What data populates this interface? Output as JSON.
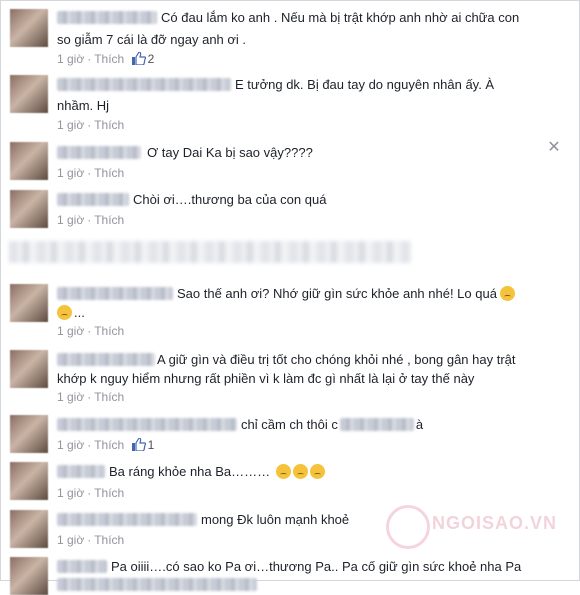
{
  "meta_like_label": "Thích",
  "meta_separator": "·",
  "comments": [
    {
      "text1": "Có đau lắm ko anh . Nếu mà bị trật khớp anh nhờ ai chữa con",
      "text2": "so giẫm 7 cái là đỡ ngay anh ơi .",
      "time": "1 giờ",
      "likes": "2"
    },
    {
      "text1": "E tưởng dk. Bị đau tay do nguyên nhân ấy. À",
      "text2": "nhầm. Hj",
      "time": "1 giờ"
    },
    {
      "text1": "Ơ tay Dai Ka bị sao vậy????",
      "time": "1 giờ"
    },
    {
      "text1": "Chòi ơi….thương ba của con quá",
      "time": "1 giờ"
    },
    {
      "text1": "Sao thế anh ơi? Nhớ giữ gìn sức khỏe anh nhé! Lo quá",
      "text2": "...",
      "time": "1 giờ"
    },
    {
      "text1": "A giữ gìn và điều trị tốt cho chóng khỏi nhé , bong gân hay trật",
      "text2": "khớp k nguy hiểm nhưng rất phiền vì k làm đc gì nhất là lại ở tay thế này",
      "time": "1 giờ"
    },
    {
      "text1a": "chỉ cầm ch thôi c",
      "text1b": "à",
      "time": "1 giờ",
      "likes": "1"
    },
    {
      "text1": "Ba ráng khỏe nha Ba………",
      "time": "1 giờ"
    },
    {
      "text1": "mong Đk luôn mạnh khoẻ",
      "time": "1 giờ"
    },
    {
      "text1": "Pa oiiii….có sao ko Pa ơi…thương Pa.. Pa cố giữ gìn sức khoẻ nha Pa"
    }
  ],
  "watermark": "NGOISAO.VN",
  "icons": {
    "like": "thumbs-up-icon",
    "close": "close-icon",
    "emoji": "sad-face-icon"
  },
  "colors": {
    "link": "#90949c",
    "text": "#1d2129",
    "like_icon": "#4267b2"
  }
}
